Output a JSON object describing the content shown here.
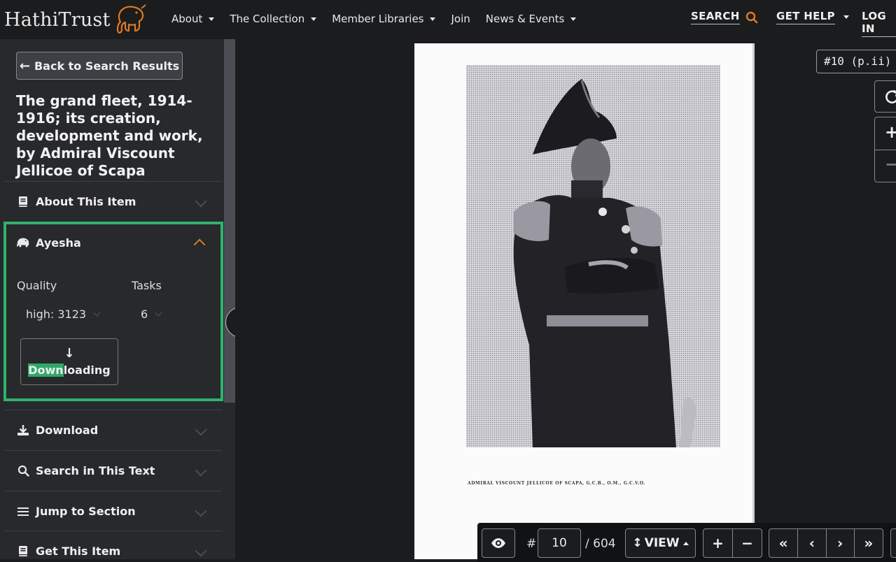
{
  "brand": {
    "name": "HathiTrust",
    "accent": "#e07a20"
  },
  "nav": {
    "items": [
      {
        "label": "About"
      },
      {
        "label": "The Collection"
      },
      {
        "label": "Member Libraries"
      },
      {
        "label": "Join"
      },
      {
        "label": "News & Events"
      }
    ],
    "search_label": "SEARCH",
    "help_label": "GET HELP",
    "login_label": "LOG IN"
  },
  "sidebar": {
    "back_label": "Back to Search Results",
    "title": "The grand fleet, 1914-1916; its creation, development and work, by Admiral Viscount Jellicoe of Scapa",
    "panels": {
      "about": "About This Item",
      "ayesha": "Ayesha",
      "download": "Download",
      "search_text": "Search in This Text",
      "jump": "Jump to Section",
      "get_item": "Get This Item"
    },
    "ayesha": {
      "quality_label": "Quality",
      "quality_value": "high: 3123",
      "tasks_label": "Tasks",
      "tasks_value": "6",
      "button_done": "Down",
      "button_rest": "loading",
      "highlight_color": "#2fb36a"
    }
  },
  "viewer": {
    "page_tag": "#10 (p.ii)",
    "caption": "ADMIRAL VISCOUNT JELLICOE OF SCAPA, G.C.B., O.M., G.C.V.O.",
    "toolbar": {
      "hash": "#",
      "page_value": "10",
      "page_total": "/ 604",
      "view_label": "VIEW"
    }
  }
}
